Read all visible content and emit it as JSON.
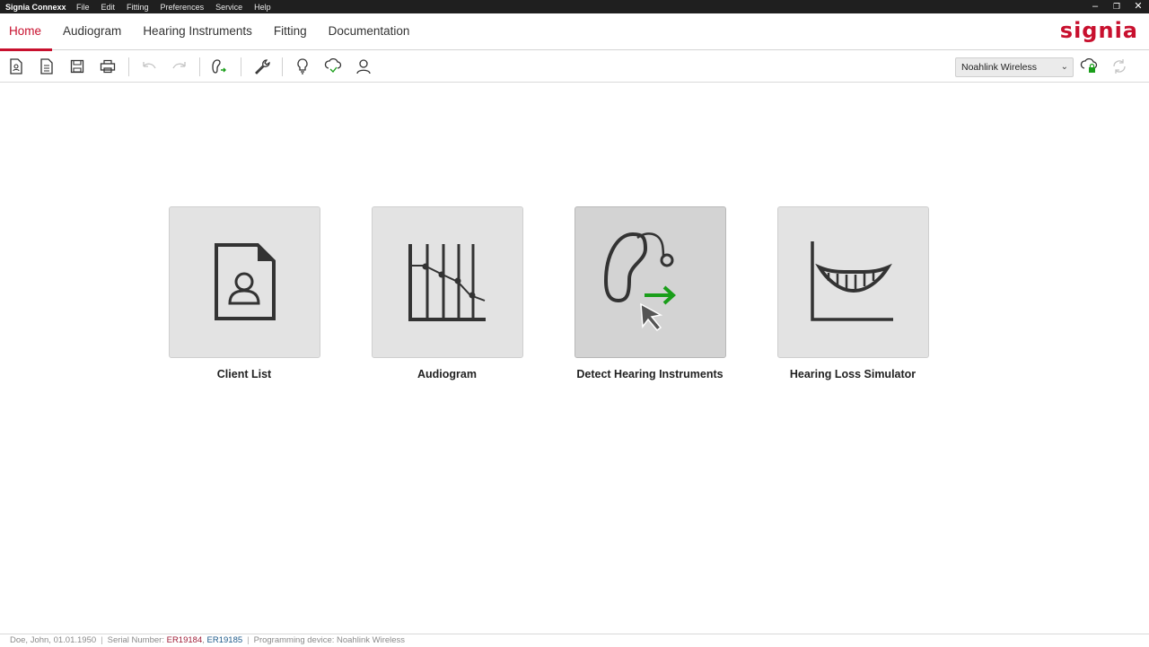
{
  "titlebar": {
    "app_title": "Signia Connexx",
    "menu": [
      "File",
      "Edit",
      "Fitting",
      "Preferences",
      "Service",
      "Help"
    ],
    "controls": {
      "minimize": "–",
      "restore": "❐",
      "close": "✕"
    }
  },
  "nav": {
    "tabs": [
      {
        "label": "Home",
        "active": true
      },
      {
        "label": "Audiogram",
        "active": false
      },
      {
        "label": "Hearing Instruments",
        "active": false
      },
      {
        "label": "Fitting",
        "active": false
      },
      {
        "label": "Documentation",
        "active": false
      }
    ],
    "brand": "signia"
  },
  "toolbar": {
    "icons": [
      "new-client-icon",
      "document-icon",
      "save-icon",
      "print-icon",
      "undo-icon",
      "redo-icon",
      "detect-hearing-instrument-icon",
      "wrench-icon",
      "lightbulb-icon",
      "cloud-check-icon",
      "user-icon"
    ],
    "device": {
      "selected": "Noahlink Wireless"
    },
    "right_icons": [
      "cloud-lock-icon",
      "refresh-icon"
    ]
  },
  "tiles": [
    {
      "label": "Client List",
      "icon": "client-list-icon"
    },
    {
      "label": "Audiogram",
      "icon": "audiogram-icon"
    },
    {
      "label": "Detect Hearing Instruments",
      "icon": "hearing-instrument-detect-icon"
    },
    {
      "label": "Hearing Loss Simulator",
      "icon": "hearing-loss-simulator-icon"
    }
  ],
  "status": {
    "client": "Doe, John, 01.01.1950",
    "serial_label": "Serial Number:",
    "serial_1": "ER19184",
    "serial_2": "ER19185",
    "programming_device": "Programming device: Noahlink Wireless"
  },
  "colors": {
    "accent": "#c8102e",
    "detect_arrow": "#1a9e1a",
    "tile_bg": "#e3e3e3"
  }
}
